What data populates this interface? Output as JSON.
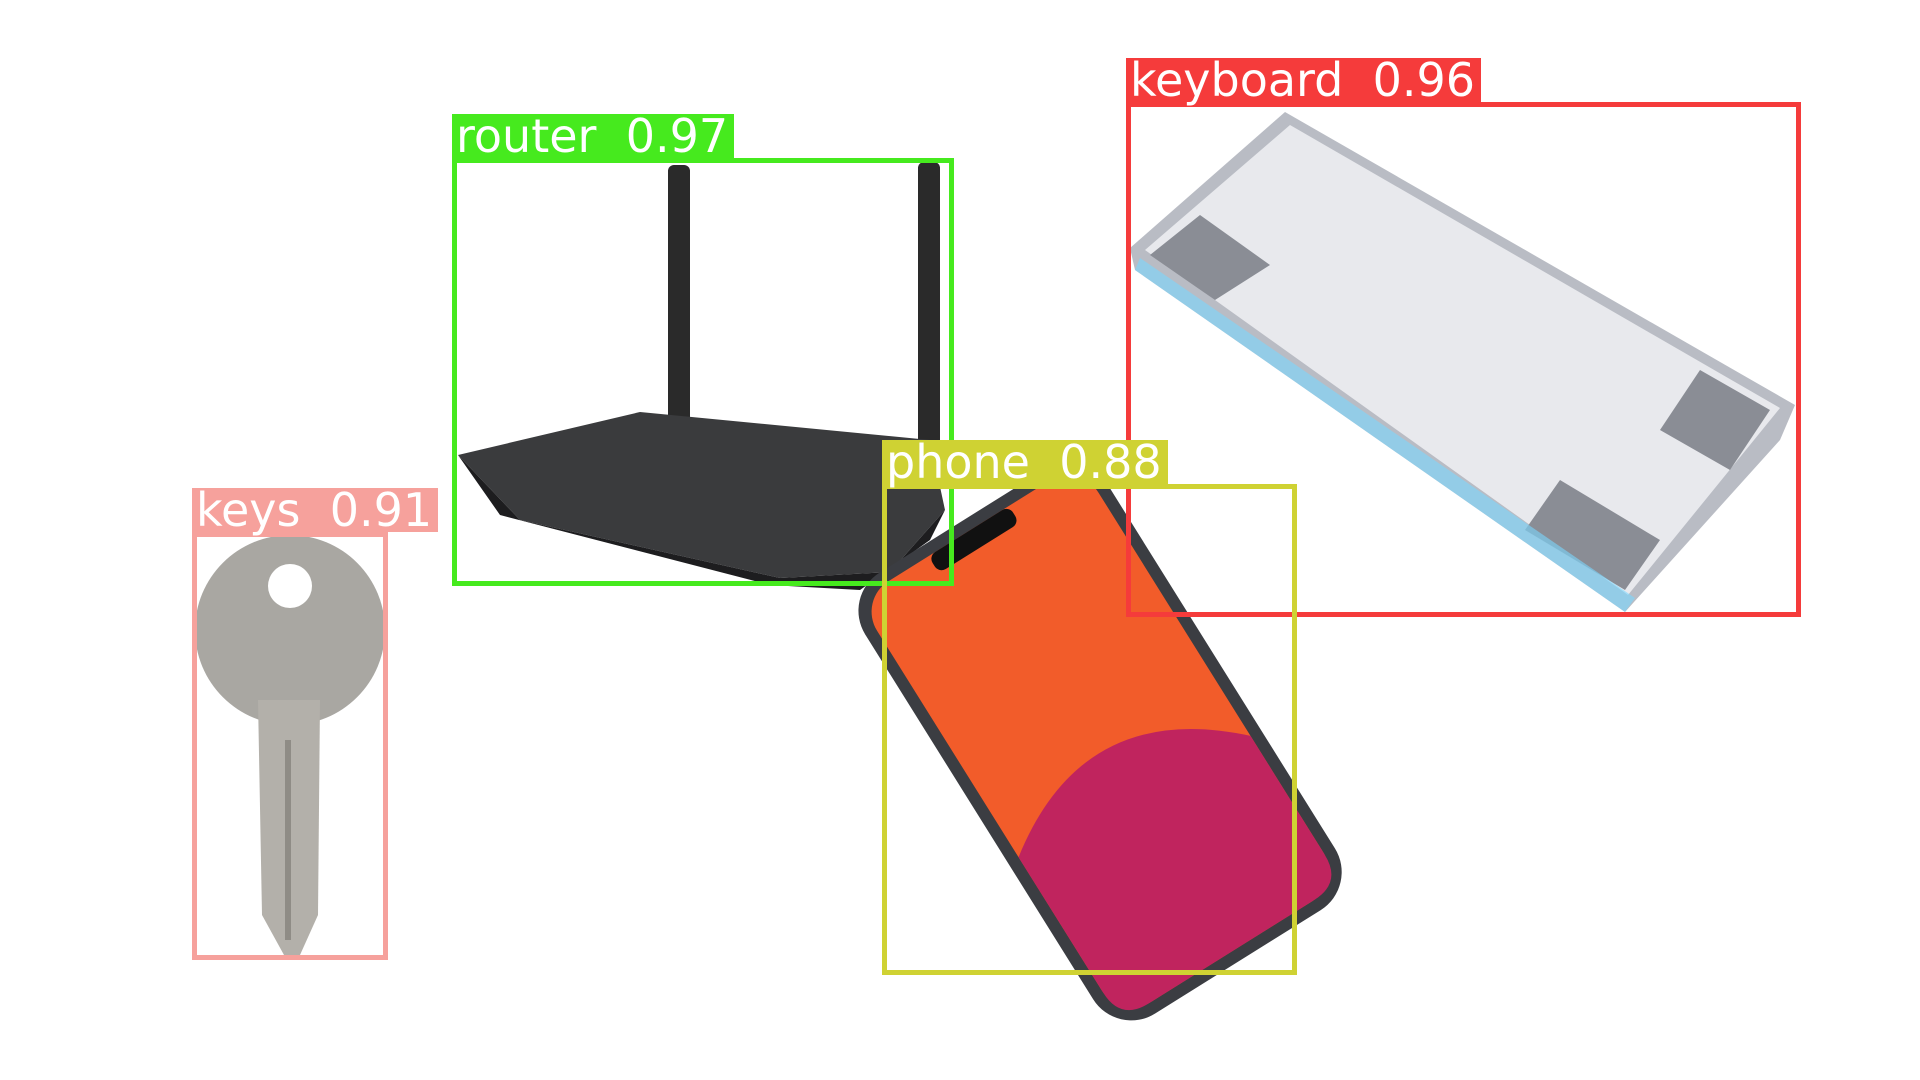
{
  "detections": [
    {
      "class": "router",
      "label": "router  0.97",
      "confidence": 0.97,
      "color": "#46EA1E"
    },
    {
      "class": "keyboard",
      "label": "keyboard  0.96",
      "confidence": 0.96,
      "color": "#F53B3B"
    },
    {
      "class": "phone",
      "label": "phone  0.88",
      "confidence": 0.88,
      "color": "#CFD233"
    },
    {
      "class": "keys",
      "label": "keys  0.91",
      "confidence": 0.91,
      "color": "#F6A19C"
    }
  ]
}
